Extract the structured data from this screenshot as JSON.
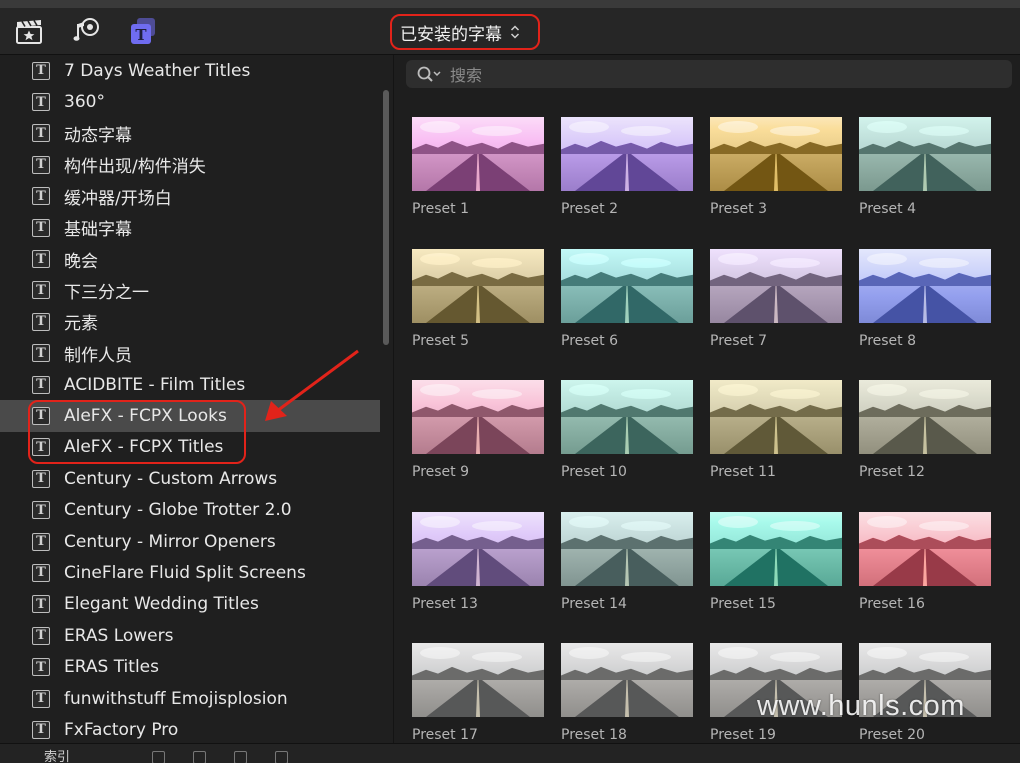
{
  "toolbar": {
    "icons": [
      "clapperboard-star-icon",
      "music-camera-icon",
      "titles-icon"
    ],
    "active_color": "#6f6cf0",
    "dropdown_label": "已安装的字幕"
  },
  "search": {
    "placeholder": "搜索"
  },
  "sidebar": {
    "items": [
      {
        "label": "7 Days Weather Titles"
      },
      {
        "label": "360°"
      },
      {
        "label": "动态字幕"
      },
      {
        "label": "构件出现/构件消失"
      },
      {
        "label": "缓冲器/开场白"
      },
      {
        "label": "基础字幕"
      },
      {
        "label": "晚会"
      },
      {
        "label": "下三分之一"
      },
      {
        "label": "元素"
      },
      {
        "label": "制作人员"
      },
      {
        "label": "ACIDBITE - Film Titles"
      },
      {
        "label": "AleFX - FCPX Looks",
        "selected": true
      },
      {
        "label": "AleFX - FCPX Titles"
      },
      {
        "label": "Century - Custom Arrows"
      },
      {
        "label": "Century - Globe Trotter 2.0"
      },
      {
        "label": "Century - Mirror Openers"
      },
      {
        "label": "CineFlare Fluid Split Screens"
      },
      {
        "label": "Elegant Wedding Titles"
      },
      {
        "label": "ERAS Lowers"
      },
      {
        "label": "ERAS Titles"
      },
      {
        "label": "funwithstuff Emojisplosion"
      },
      {
        "label": "FxFactory Pro"
      }
    ]
  },
  "presets": [
    {
      "label": "Preset 1",
      "tint": "#c07ab8"
    },
    {
      "label": "Preset 2",
      "tint": "#7a5ab8"
    },
    {
      "label": "Preset 3",
      "tint": "#d2b060"
    },
    {
      "label": "Preset 4",
      "tint": "#8ab0a8"
    },
    {
      "label": "Preset 5",
      "tint": "#b0a070"
    },
    {
      "label": "Preset 6",
      "tint": "#5a9a98"
    },
    {
      "label": "Preset 7",
      "tint": "#a090b0"
    },
    {
      "label": "Preset 8",
      "tint": "#5060c0"
    },
    {
      "label": "Preset 9",
      "tint": "#b07088"
    },
    {
      "label": "Preset 10",
      "tint": "#5a8a80"
    },
    {
      "label": "Preset 11",
      "tint": "#b0a880"
    },
    {
      "label": "Preset 12",
      "tint": "#9a9a88"
    },
    {
      "label": "Preset 13",
      "tint": "#8a70a8"
    },
    {
      "label": "Preset 14",
      "tint": "#708a88"
    },
    {
      "label": "Preset 15",
      "tint": "#3a9a88"
    },
    {
      "label": "Preset 16",
      "tint": "#c05060"
    },
    {
      "label": "Preset 17",
      "tint": "#909090"
    },
    {
      "label": "Preset 18",
      "tint": "#7a7a7a"
    },
    {
      "label": "Preset 19",
      "tint": "#d0d0d0"
    },
    {
      "label": "Preset 20",
      "tint": "#404040"
    }
  ],
  "bottom": {
    "label": "索引"
  },
  "annotation_color": "#e2231a",
  "watermark": "www.hunls.com"
}
